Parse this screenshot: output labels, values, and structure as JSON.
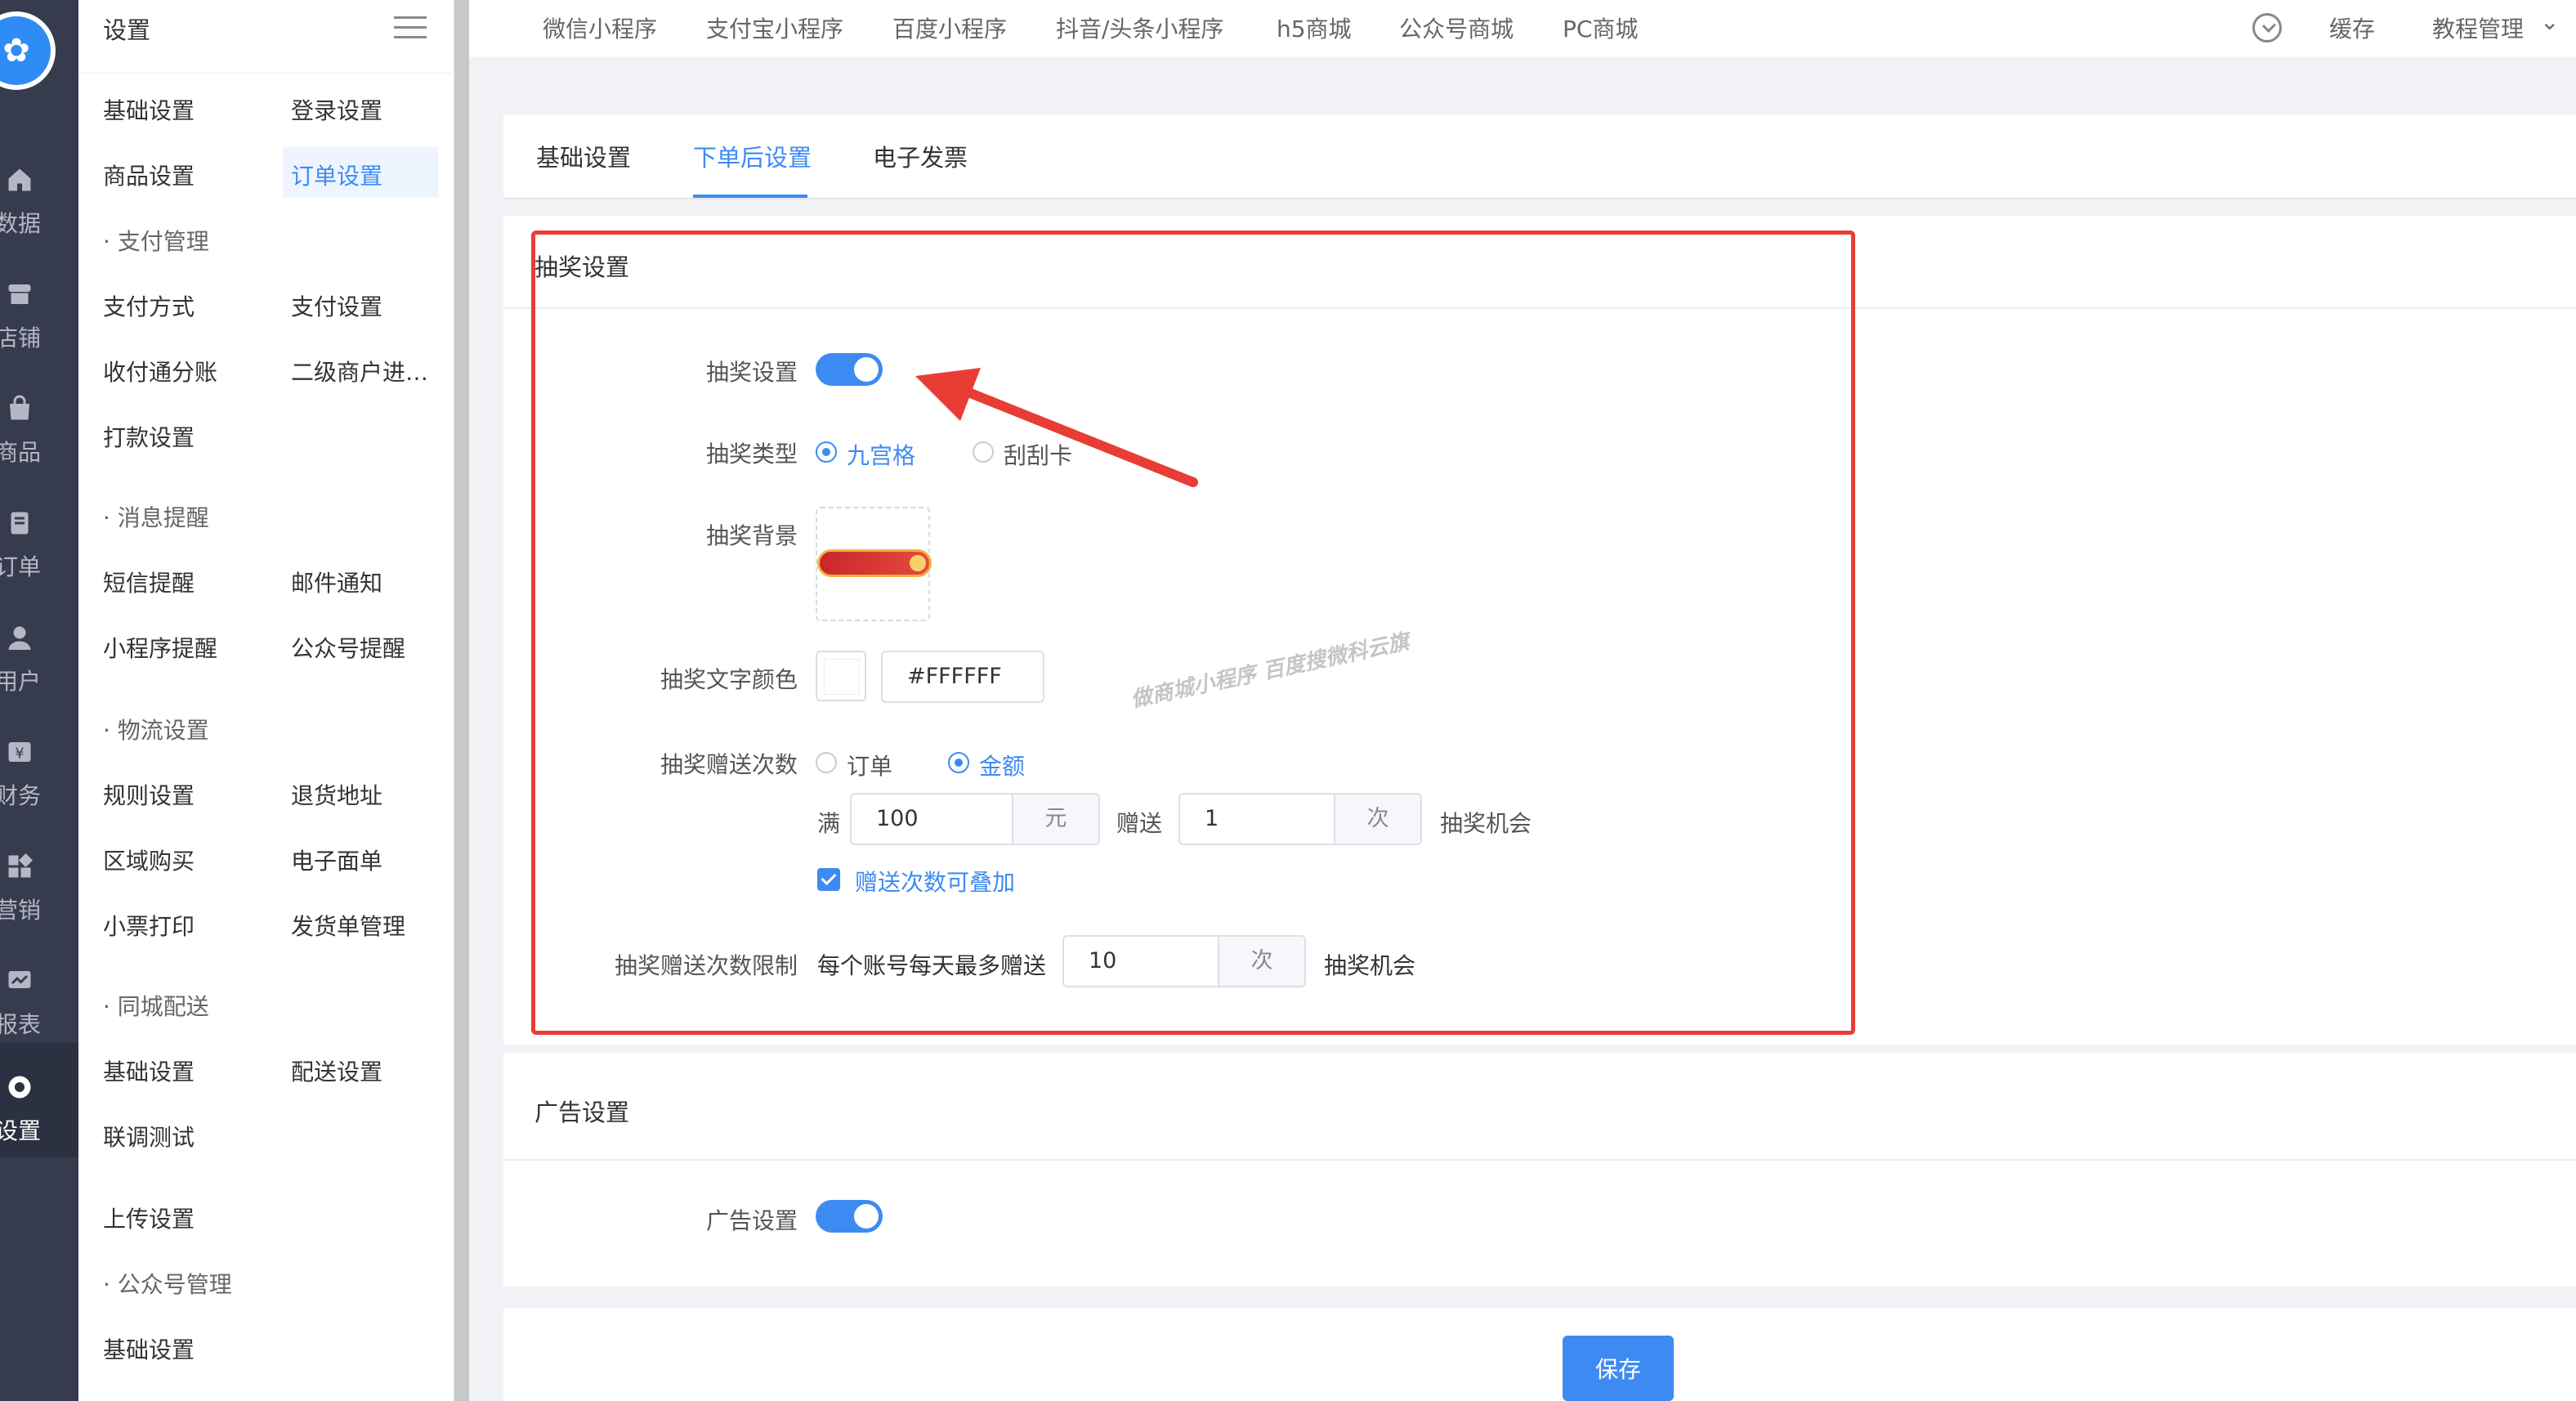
{
  "rail": {
    "items": [
      {
        "label": "数据",
        "icon": "home-icon"
      },
      {
        "label": "店铺",
        "icon": "store-icon"
      },
      {
        "label": "商品",
        "icon": "bag-icon"
      },
      {
        "label": "订单",
        "icon": "order-icon"
      },
      {
        "label": "用户",
        "icon": "user-icon"
      },
      {
        "label": "财务",
        "icon": "finance-icon"
      },
      {
        "label": "营销",
        "icon": "marketing-icon"
      },
      {
        "label": "报表",
        "icon": "report-icon"
      },
      {
        "label": "设置",
        "icon": "gear-icon"
      }
    ]
  },
  "subnav": {
    "title": "设置",
    "items": {
      "basic": "基础设置",
      "login": "登录设置",
      "goods": "商品设置",
      "order": "订单设置",
      "pay_group": "· 支付管理",
      "pay_method": "支付方式",
      "pay_setting": "支付设置",
      "split": "收付通分账",
      "sub_merchant": "二级商户进…",
      "payout": "打款设置",
      "msg_group": "· 消息提醒",
      "sms": "短信提醒",
      "email": "邮件通知",
      "mini_msg": "小程序提醒",
      "mp_msg": "公众号提醒",
      "logistics_group": "· 物流设置",
      "rules": "规则设置",
      "return_addr": "退货地址",
      "region": "区域购买",
      "e_waybill": "电子面单",
      "receipt": "小票打印",
      "shipping": "发货单管理",
      "city_group": "· 同城配送",
      "city_basic": "基础设置",
      "delivery": "配送设置",
      "debug": "联调测试",
      "upload": "上传设置",
      "mp_group": "· 公众号管理",
      "mp_basic": "基础设置"
    }
  },
  "topbar": {
    "tabs": [
      "微信小程序",
      "支付宝小程序",
      "百度小程序",
      "抖音/头条小程序",
      "h5商城",
      "公众号商城",
      "PC商城"
    ],
    "cache": "缓存",
    "tutorial": "教程管理"
  },
  "content_tabs": [
    "基础设置",
    "下单后设置",
    "电子发票"
  ],
  "lottery": {
    "section_title": "抽奖设置",
    "toggle_label": "抽奖设置",
    "type_label": "抽奖类型",
    "type_options": [
      "九宫格",
      "刮刮卡"
    ],
    "bg_label": "抽奖背景",
    "text_color_label": "抽奖文字颜色",
    "text_color_value": "#FFFFFF",
    "gift_count_label": "抽奖赠送次数",
    "gift_options": [
      "订单",
      "金额"
    ],
    "full_label": "满",
    "full_value": "100",
    "full_unit": "元",
    "gift_label": "赠送",
    "gift_value": "1",
    "gift_unit": "次",
    "chance_label": "抽奖机会",
    "stack_label": "赠送次数可叠加",
    "limit_label": "抽奖赠送次数限制",
    "limit_prefix": "每个账号每天最多赠送",
    "limit_value": "10",
    "limit_unit": "次",
    "limit_suffix": "抽奖机会"
  },
  "ad": {
    "section_title": "广告设置",
    "toggle_label": "广告设置"
  },
  "watermark": "做商城小程序 百度搜微科云旗",
  "save_label": "保存",
  "colors": {
    "accent": "#3d8bf2",
    "annotation": "#e83d35"
  }
}
